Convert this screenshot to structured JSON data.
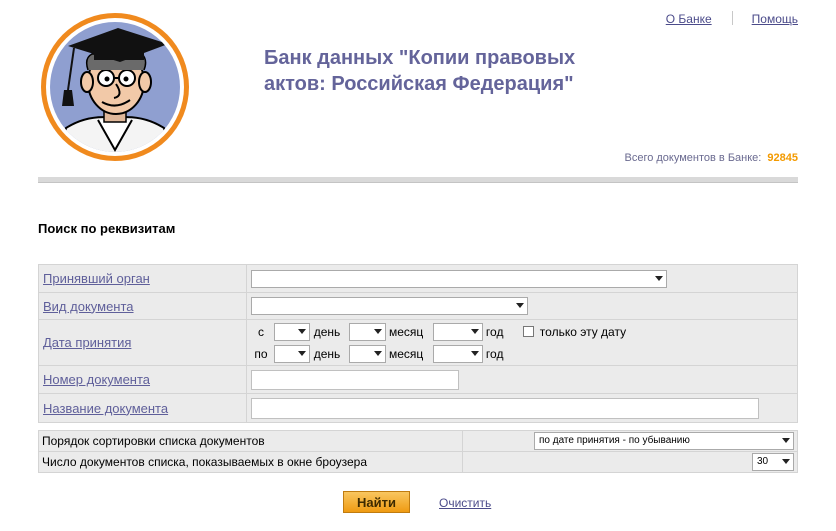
{
  "header": {
    "title_line1": "Банк данных \"Копии правовых",
    "title_line2": "актов: Российская Федерация\"",
    "links": {
      "about": "О Банке",
      "help": "Помощь"
    },
    "doc_count_label": "Всего документов в Банке:",
    "doc_count_value": "92845"
  },
  "search": {
    "heading": "Поиск по реквизитам",
    "fields": {
      "authority": {
        "label": "Принявший орган",
        "value": ""
      },
      "doc_type": {
        "label": "Вид документа",
        "value": ""
      },
      "date": {
        "label": "Дата принятия",
        "from": "с",
        "to": "по",
        "day": "день",
        "month": "месяц",
        "year": "год",
        "only_this_date": "только эту дату"
      },
      "doc_number": {
        "label": "Номер документа",
        "value": ""
      },
      "doc_name": {
        "label": "Название документа",
        "value": ""
      }
    },
    "sort": {
      "order_label": "Порядок сортировки списка документов",
      "order_value": "по дате принятия - по убыванию",
      "count_label": "Число документов списка, показываемых в окне броузера",
      "count_value": "30"
    },
    "buttons": {
      "find": "Найти",
      "clear": "Очистить"
    }
  },
  "colors": {
    "title": "#64649a",
    "accent": "#f39a00",
    "link": "#4b4b8a"
  },
  "icons": [
    "professor-logo",
    "chevron-down-icon",
    "checkbox"
  ]
}
